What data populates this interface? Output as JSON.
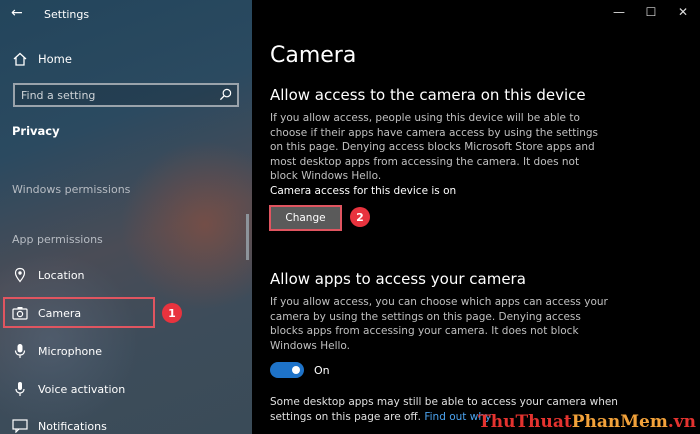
{
  "window": {
    "title": "Settings",
    "back_glyph": "←",
    "minimize_glyph": "—",
    "maximize_glyph": "☐",
    "close_glyph": "✕"
  },
  "sidebar": {
    "home_label": "Home",
    "search_placeholder": "Find a setting",
    "category": "Privacy",
    "section_windows": "Windows permissions",
    "section_app": "App permissions",
    "items": [
      {
        "label": "Location",
        "icon": "location-icon"
      },
      {
        "label": "Camera",
        "icon": "camera-icon",
        "selected": true
      },
      {
        "label": "Microphone",
        "icon": "microphone-icon"
      },
      {
        "label": "Voice activation",
        "icon": "voice-activation-icon"
      },
      {
        "label": "Notifications",
        "icon": "notifications-icon"
      }
    ]
  },
  "main": {
    "title": "Camera",
    "section1_heading": "Allow access to the camera on this device",
    "section1_text": "If you allow access, people using this device will be able to choose if their apps have camera access by using the settings on this page. Denying access blocks Microsoft Store apps and most desktop apps from accessing the camera. It does not block Windows Hello.",
    "status_text": "Camera access for this device is on",
    "change_label": "Change",
    "section2_heading": "Allow apps to access your camera",
    "section2_text": "If you allow access, you can choose which apps can access your camera by using the settings on this page. Denying access blocks apps from accessing your camera. It does not block Windows Hello.",
    "toggle_label": "On",
    "toggle_state": true,
    "note_text": "Some desktop apps may still be able to access your camera when settings on this page are off.",
    "note_link": "Find out why"
  },
  "annotations": {
    "badge1": "1",
    "badge2": "2",
    "highlight_color": "#e05560",
    "badge_color": "#e8333e"
  },
  "watermark": {
    "part1": "ThuThuat",
    "part2": "PhanMem",
    "part3": ".vn"
  },
  "colors": {
    "accent": "#1e73c9",
    "link": "#4ba3ef"
  }
}
